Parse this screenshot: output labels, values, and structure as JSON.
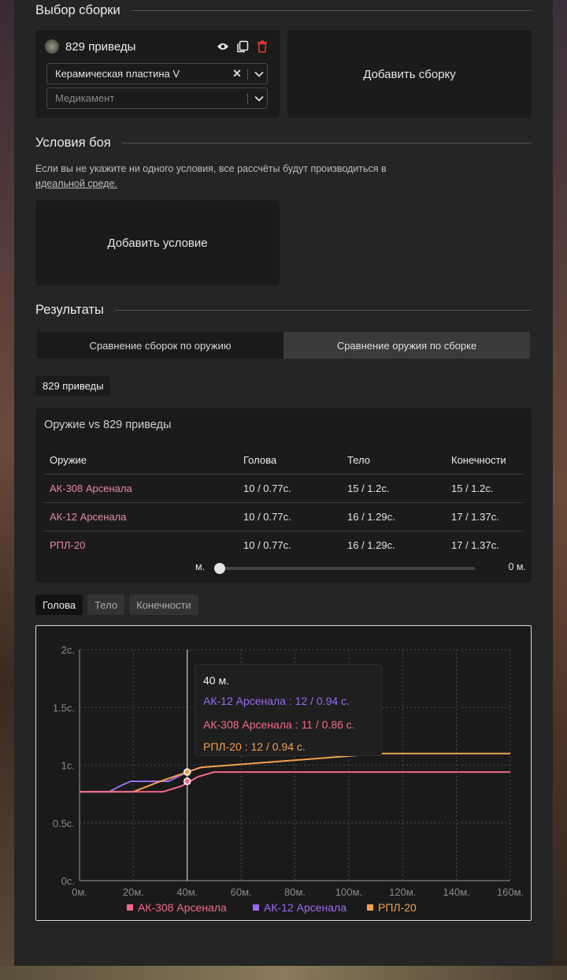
{
  "builds_section": {
    "title": "Выбор сборки"
  },
  "build": {
    "name": "829 приведы",
    "armor_value": "Керамическая пластина V",
    "medicine_placeholder": "Медикамент"
  },
  "add_build_label": "Добавить сборку",
  "conditions_section": {
    "title": "Условия боя",
    "note_text": "Если вы не укажите ни одного условия, все рассчёты будут производиться в",
    "note_link": "идеальной среде."
  },
  "add_condition_label": "Добавить условие",
  "results_section": {
    "title": "Результаты",
    "tabs": [
      {
        "label": "Сравнение сборок по оружию"
      },
      {
        "label": "Сравнение оружия по сборке"
      }
    ],
    "selected_build_chip": "829 приведы"
  },
  "table": {
    "title": "Оружие vs 829 приведы",
    "headers": [
      "Оружие",
      "Голова",
      "Тело",
      "Конечности"
    ],
    "rows": [
      [
        "АК-308 Арсенала",
        "10 / 0.77с.",
        "15 / 1.2с.",
        "15 / 1.2с."
      ],
      [
        "АК-12 Арсенала",
        "10 / 0.77с.",
        "16 / 1.29с.",
        "17 / 1.37с."
      ],
      [
        "РПЛ-20",
        "10 / 0.77с.",
        "16 / 1.29с.",
        "17 / 1.37с."
      ]
    ],
    "range_start": "м.",
    "range_end": "0 м.",
    "range_value_fraction": 0
  },
  "body_tabs": [
    {
      "label": "Голова"
    },
    {
      "label": "Тело"
    },
    {
      "label": "Конечности"
    }
  ],
  "colors": {
    "ak308": "#f06a8a",
    "ak12": "#9a6af0",
    "rpl20": "#f0a050"
  },
  "icons": [
    "eye-icon",
    "copy-icon",
    "trash-icon",
    "chevron-down-icon",
    "clear-icon"
  ],
  "chart_data": {
    "type": "line",
    "x": [
      0,
      20,
      40,
      60,
      80,
      100,
      120,
      140,
      160
    ],
    "x_tick_labels": [
      "0м.",
      "20м.",
      "40м.",
      "60м.",
      "80м.",
      "100м.",
      "120м.",
      "140м.",
      "160м."
    ],
    "y_tick_labels": [
      "0с.",
      "0.5с.",
      "1с.",
      "1.5с.",
      "2с."
    ],
    "xlim": [
      0,
      160
    ],
    "ylim": [
      0,
      2
    ],
    "grid": true,
    "legend_position": "bottom",
    "series": [
      {
        "name": "АК-308 Арсенала",
        "color": "#f06a8a",
        "points": [
          [
            0,
            0.77
          ],
          [
            31,
            0.77
          ],
          [
            38,
            0.82
          ],
          [
            44,
            0.9
          ],
          [
            50,
            0.94
          ],
          [
            160,
            0.94
          ]
        ]
      },
      {
        "name": "АК-12 Арсенала",
        "color": "#9a6af0",
        "points": [
          [
            0,
            0.77
          ],
          [
            11,
            0.77
          ],
          [
            16,
            0.83
          ],
          [
            19,
            0.86
          ],
          [
            33,
            0.86
          ],
          [
            40,
            0.94
          ]
        ]
      },
      {
        "name": "РПЛ-20",
        "color": "#f0a050",
        "points": [
          [
            0,
            0.77
          ],
          [
            20,
            0.77
          ],
          [
            30,
            0.86
          ],
          [
            40,
            0.94
          ],
          [
            45,
            0.98
          ],
          [
            112,
            1.1
          ],
          [
            160,
            1.1
          ]
        ]
      }
    ],
    "hover": {
      "x": 40,
      "title": "40 м.",
      "lines": [
        {
          "text": "АК-12 Арсенала : 12 / 0.94 с.",
          "color": "#9a6af0"
        },
        {
          "text": "АК-308 Арсенала : 11 / 0.86 с.",
          "color": "#f06a8a"
        },
        {
          "text": "РПЛ-20 : 12 / 0.94 с.",
          "color": "#f0a050"
        }
      ],
      "markers": [
        {
          "y": 0.94,
          "color": "#f0a050"
        },
        {
          "y": 0.86,
          "color": "#f06a8a"
        }
      ]
    }
  }
}
